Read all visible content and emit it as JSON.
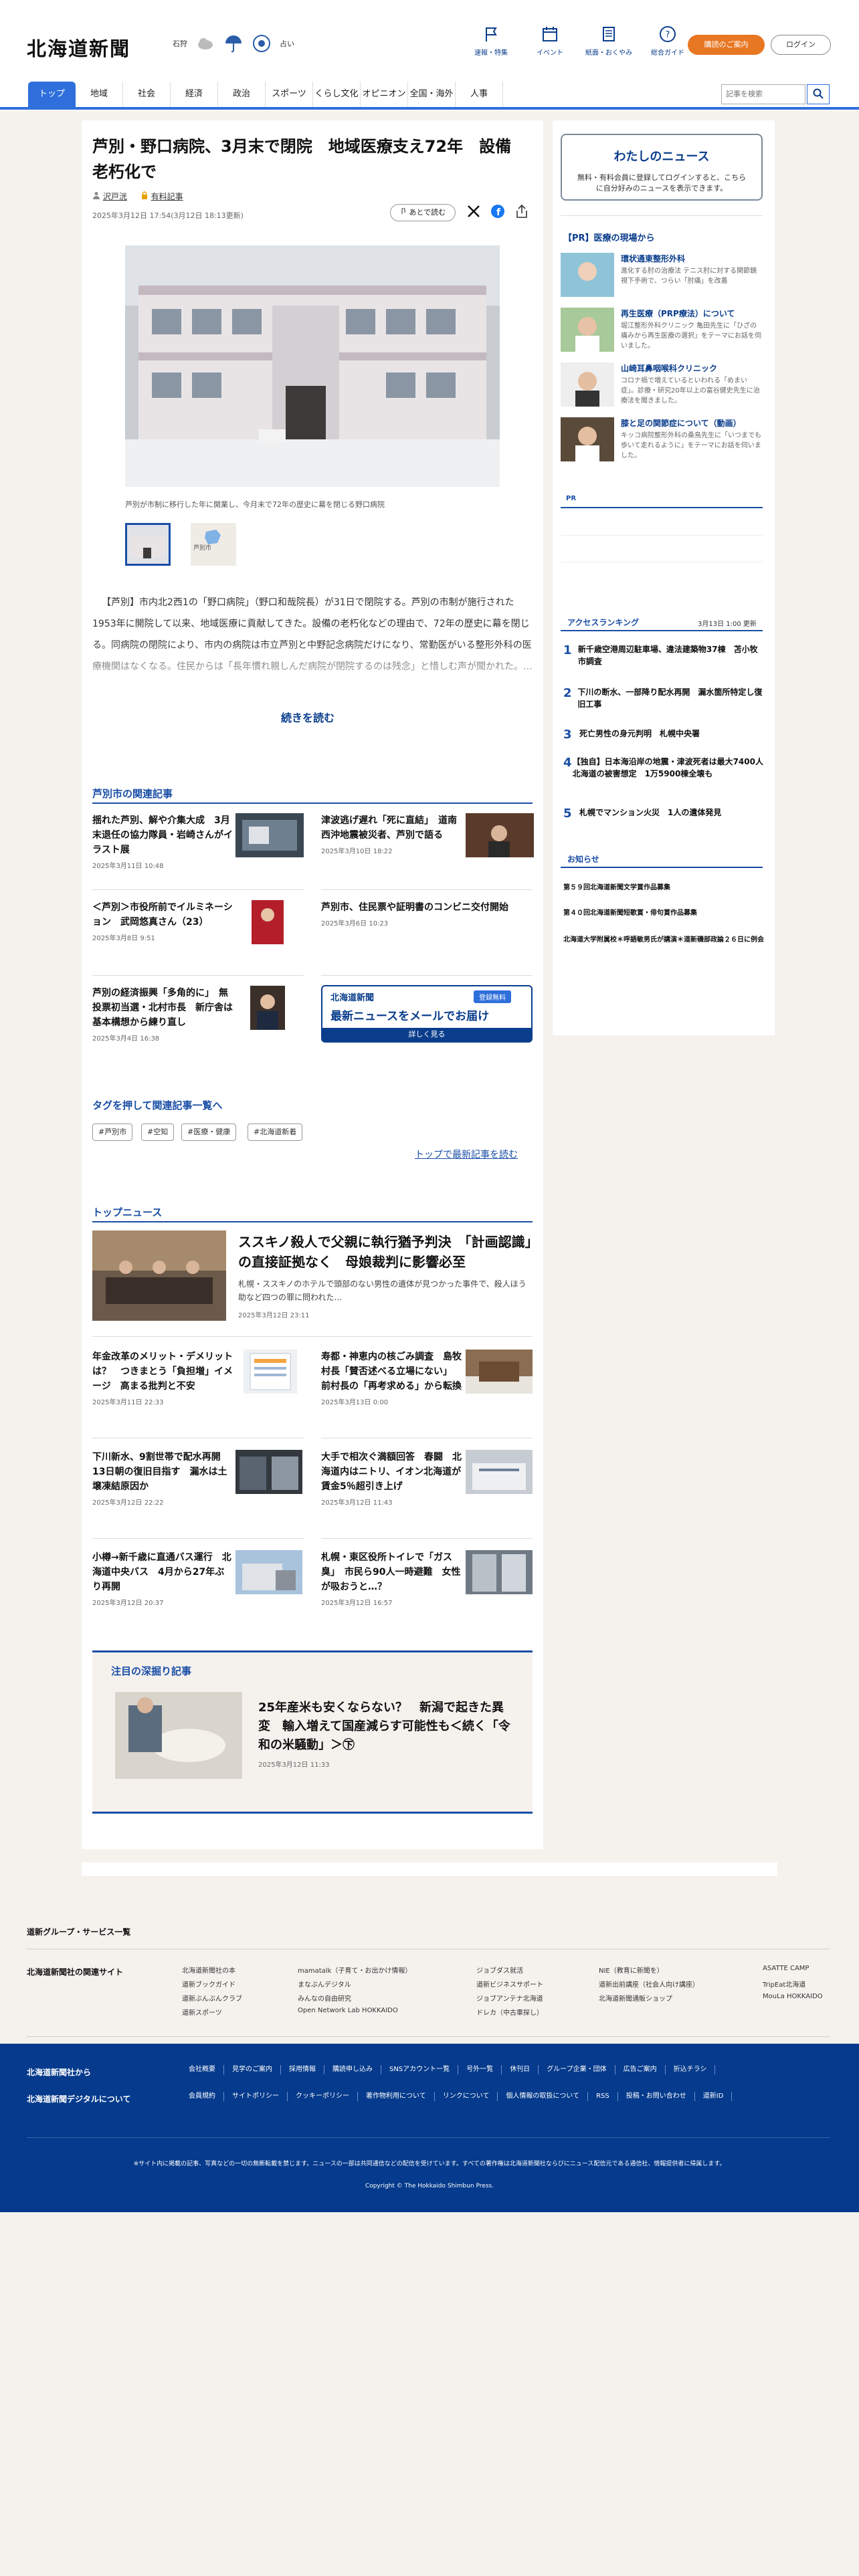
{
  "header": {
    "logo": "北海道新聞",
    "weather_city": "石狩",
    "weather_text": "占い",
    "icons": [
      "速報・特集",
      "イベント",
      "紙面・おくやみ",
      "総合ガイド"
    ],
    "subscribe": "購読のご案内",
    "login": "ログイン"
  },
  "nav": {
    "items": [
      "トップ",
      "地域",
      "社会",
      "経済",
      "政治",
      "スポーツ",
      "くらし文化",
      "オピニオン",
      "全国・海外",
      "人事"
    ],
    "search_placeholder": "記事を検索"
  },
  "article": {
    "title": "芦別・野口病院、3月末で閉院　地域医療支え72年　設備老朽化で",
    "author": "沢戸洸",
    "tag": "有料記事",
    "date": "2025年3月12日 17:54(3月12日 18:13更新)",
    "save": "あとで読む",
    "caption": "芦別が市制に移行した年に開業し、今月末で72年の歴史に幕を閉じる野口病院",
    "thumb2_label": "芦別市",
    "body": "【芦別】市内北2西1の「野口病院」（野口和哉院長）が31日で閉院する。芦別の市制が施行された1953年に開院して以来、地域医療に貢献してきた。設備の老朽化などの理由で、72年の歴史に幕を閉じる。同病院の閉院により、市内の病院は市立芦別と中野記念病院だけになり、常勤医がいる整形外科の医療機関はなくなる。住民からは「長年慣れ親しんだ病院が閉院するのは残念」と惜しむ声が聞かれた。…",
    "read_more": "続きを読む"
  },
  "related": {
    "heading": "芦別市の関連記事",
    "items": [
      {
        "title": "揺れた芦別、解や介集大成　3月末退任の協力隊員・岩崎さんがイラスト展",
        "date": "2025年3月11日 10:48"
      },
      {
        "title": "津波逃げ遅れ「死に直結」　道南西沖地震被災者、芦別で語る",
        "date": "2025年3月10日 18:22"
      },
      {
        "title": "＜芦別＞市役所前でイルミネーション　武岡悠真さん（23）",
        "date": "2025年3月8日 9:51"
      },
      {
        "title": "芦別市、住民票や証明書のコンビニ交付開始",
        "date": "2025年3月6日 10:23"
      },
      {
        "title": "芦別の経済振興「多角的に」　無投票初当選・北村市長　新庁舎は基本構想から練り直し",
        "date": "2025年3月4日 16:38"
      }
    ],
    "mail_logo": "北海道新聞",
    "mail_badge": "登録無料",
    "mail_title": "最新ニュースをメールでお届け",
    "mail_more": "詳しく見る"
  },
  "tags": {
    "heading": "タグを押して関連記事一覧へ",
    "items": [
      "#芦別市",
      "#空知",
      "#医療・健康",
      "#北海道新着"
    ],
    "latest": "トップで最新記事を読む"
  },
  "top_news": {
    "heading": "トップニュース",
    "lead_title": "ススキノ殺人で父親に執行猶予判決　「計画認識」の直接証拠なく　母娘裁判に影響必至",
    "lead_desc": "札幌・ススキノのホテルで頭部のない男性の遺体が見つかった事件で、殺人ほう助など四つの罪に問われた…",
    "lead_date": "2025年3月12日 23:11",
    "items": [
      {
        "title": "年金改革のメリット・デメリットは？　つきまとう「負担増」イメージ　高まる批判と不安",
        "date": "2025年3月11日 22:33"
      },
      {
        "title": "寿都・神恵内の核ごみ調査　島牧村長「賛否述べる立場にない」　前村長の「再考求める」から転換",
        "date": "2025年3月13日 0:00"
      },
      {
        "title": "下川新水、9割世帯で配水再開　13日朝の復旧目指す　漏水は土壌凍結原因か",
        "date": "2025年3月12日 22:22"
      },
      {
        "title": "大手で相次ぐ満額回答　春闘　北海道内はニトリ、イオン北海道が賃金5％超引き上げ",
        "date": "2025年3月12日 11:43"
      },
      {
        "title": "小樽→新千歳に直通バス運行　北海道中央バス　4月から27年ぶり再開",
        "date": "2025年3月12日 20:37"
      },
      {
        "title": "札幌・東区役所トイレで「ガス臭」　市民ら90人一時避難　女性が吸おうと…？",
        "date": "2025年3月12日 16:57"
      }
    ]
  },
  "feature": {
    "heading": "注目の深掘り記事",
    "title": "25年産米も安くならない？　新潟で起きた異変　輸入増えて国産減らす可能性も＜続く「令和の米騒動」＞㊦",
    "date": "2025年3月12日 11:33"
  },
  "sidebar": {
    "mynews_title": "わたしのニュース",
    "mynews_desc": "無料・有料会員に登録してログインすると、こちらに自分好みのニュースを表示できます。",
    "pr_heading": "【PR】医療の現場から",
    "pr_items": [
      {
        "title": "環状通東整形外科",
        "desc": "進化する肘の治療法 テニス肘に対する関節鏡視下手術で、つらい「肘痛」を改善"
      },
      {
        "title": "再生医療（PRP療法）について",
        "desc": "堀江整形外科クリニック 亀田先生に「ひざの痛みから再生医療の選択」をテーマにお話を伺いました。"
      },
      {
        "title": "山崎耳鼻咽喉科クリニック",
        "desc": "コロナ禍で増えているといわれる「めまい症」。診療・研究20年以上の富谷健史先生に治療法を聞きました。"
      },
      {
        "title": "膝と足の関節症について（動画）",
        "desc": "キッコ病院整形外科の桑鳥先生に「いつまでも歩いて走れるように」をテーマにお話を伺いました。"
      }
    ],
    "pr_label": "PR",
    "ranking_heading": "アクセスランキング",
    "ranking_time": "3月13日 1:00 更新",
    "ranking": [
      "新千歳空港周辺駐車場、違法建築物37棟　苫小牧市調査",
      "下川の断水、一部降り配水再開　漏水箇所特定し復旧工事",
      "死亡男性の身元判明　札幌中央署",
      "【独自】日本海沿岸の地震・津波死者は最大7400人　北海道の被害想定　1万5900棟全壊も",
      "札幌でマンション火災　1人の遺体発見"
    ],
    "notice_heading": "お知らせ",
    "notices": [
      "第５９回北海道新聞文学賞作品募集",
      "第４０回北海道新聞短歌賞・俳句賞作品募集",
      "北海道大学附属校＊呼語敏男氏が講演＊道新磯部政論２６日に例会"
    ]
  },
  "footer": {
    "group_heading": "道新グループ・サービス一覧",
    "related_heading": "北海道新聞社の関連サイト",
    "related_cols": [
      [
        "北海道新聞社の本",
        "道新ブックガイド",
        "道新ぶんぶんクラブ",
        "道新スポーツ"
      ],
      [
        "mamatalk（子育て・お出かけ情報）",
        "まなぶんデジタル",
        "みんなの自由研究",
        "Open Network Lab HOKKAIDO"
      ],
      [
        "ジョブダス就活",
        "道新ビジネスサポート",
        "ジョブアンテナ北海道",
        "ドレカ（中古車探し）"
      ],
      [
        "NIE（教育に新聞を）",
        "道新出前講座（社会人向け講座）",
        "北海道新聞通販ショップ"
      ],
      [
        "ASATTE CAMP",
        "TripEat北海道",
        "MouLa HOKKAIDO"
      ]
    ],
    "from_company": "北海道新聞社から",
    "digital": "北海道新聞デジタルについて",
    "links1": [
      "会社概要",
      "見学のご案内",
      "採用情報",
      "購読申し込み",
      "SNSアカウント一覧",
      "号外一覧",
      "休刊日",
      "グループ企業・団体",
      "広告ご案内",
      "折込チラシ"
    ],
    "links2": [
      "会員規約",
      "サイトポリシー",
      "クッキーポリシー",
      "著作物利用について",
      "リンクについて",
      "個人情報の取扱について",
      "RSS",
      "投稿・お問い合わせ",
      "道新ID"
    ],
    "notice": "※サイト内に掲載の記事、写真などの一切の無断転載を禁じます。ニュースの一部は共同通信などの配信を受けています。すべての著作権は北海道新聞社ならびにニュース配信元である通信社、情報提供者に帰属します。",
    "copyright": "Copyright © The Hokkaido Shimbun Press."
  },
  "colors": {
    "accent": "#2e6fdb",
    "navy": "#053a8c",
    "orange": "#e87722"
  }
}
